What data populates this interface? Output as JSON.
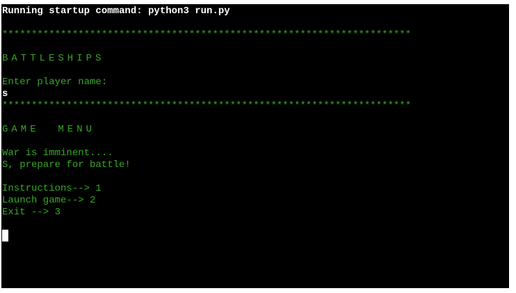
{
  "terminal": {
    "startup_command": "Running startup command: python3 run.py",
    "separator": "**********************************************************************",
    "title": "BATTLESHIPS",
    "name_prompt": "Enter player name:",
    "player_input": "s",
    "menu_title": "GAME  MENU",
    "war_message": "War is imminent....",
    "prepare_message": "S, prepare for battle!",
    "menu_options": [
      "Instructions--> 1",
      "Launch game--> 2",
      "Exit --> 3"
    ]
  },
  "colors": {
    "background": "#000000",
    "text_green": "#37a825",
    "text_white": "#ffffff"
  }
}
